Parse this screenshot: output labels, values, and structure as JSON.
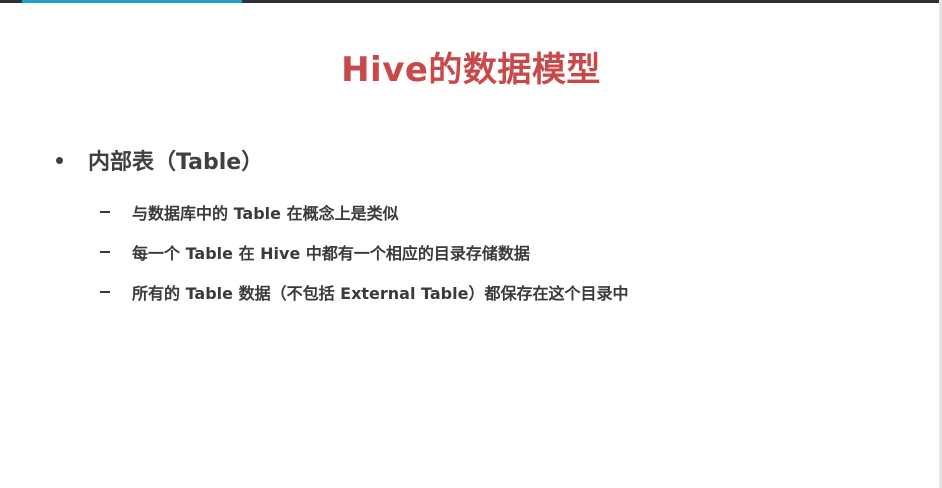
{
  "slide": {
    "title": "Hive的数据模型",
    "bullet": {
      "text": "内部表（Table）",
      "sub_items": [
        "与数据库中的 Table 在概念上是类似",
        "每一个 Table 在 Hive 中都有一个相应的目录存储数据",
        "所有的 Table 数据（不包括 External Table）都保存在这个目录中"
      ]
    }
  }
}
